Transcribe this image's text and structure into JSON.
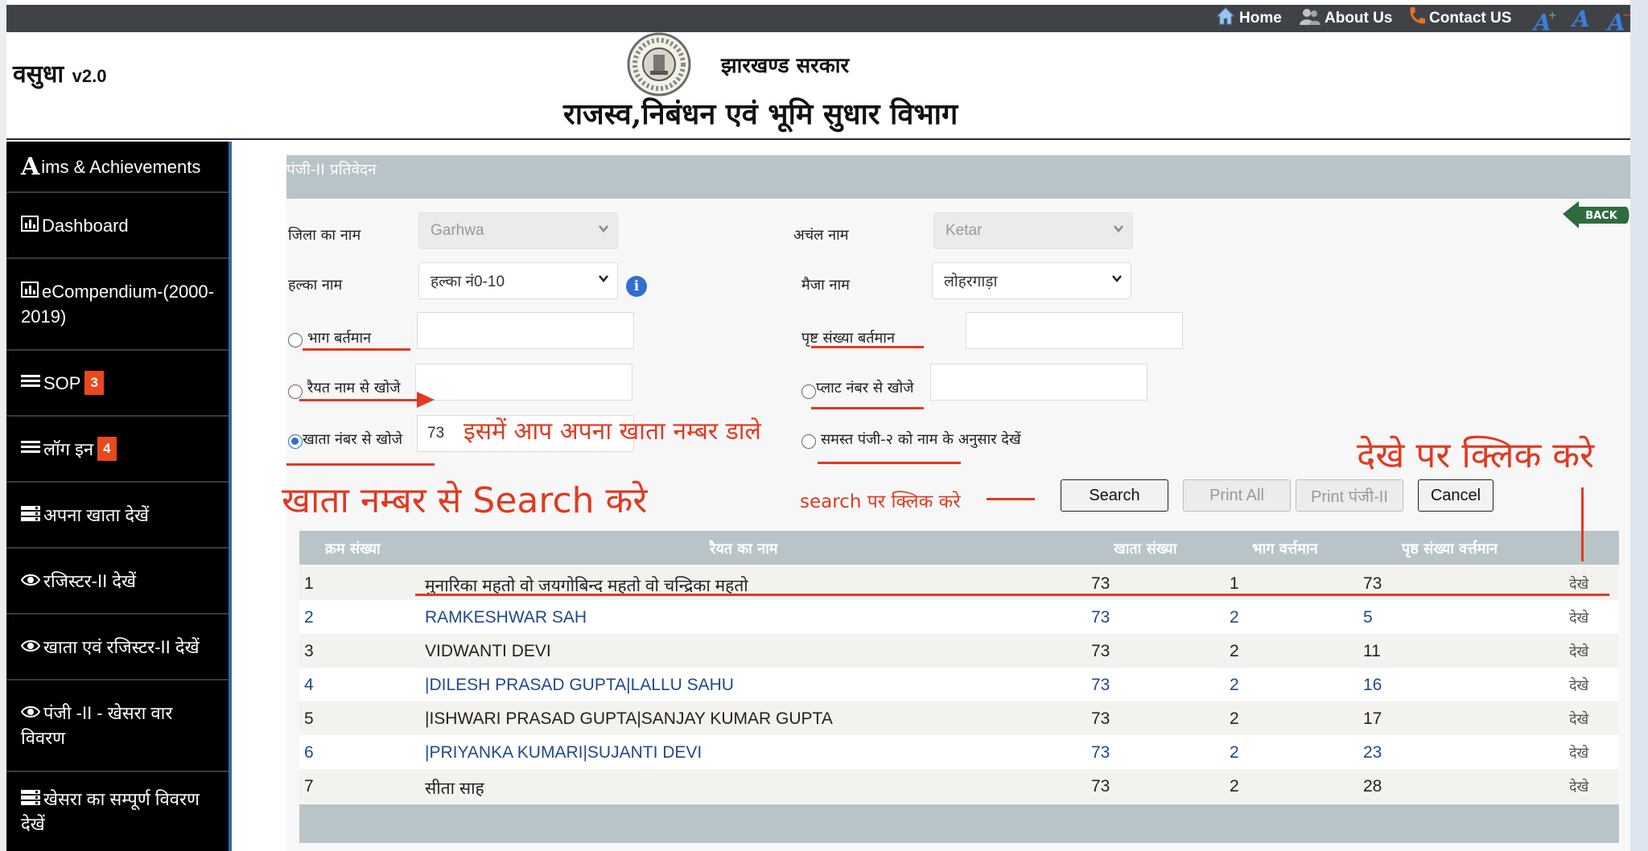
{
  "topbar": {
    "home": "Home",
    "about": "About Us",
    "contact": "Contact US",
    "font_increase": "A",
    "font_reset": "A",
    "font_decrease": "A",
    "font_increase_sign": "+",
    "font_decrease_sign": "−"
  },
  "header": {
    "brand": "वसुधा",
    "version": "v2.0",
    "gov_name": "झारखण्ड सरकार",
    "dept_name": "राजस्व,निबंधन एवं भूमि सुधार  विभाग"
  },
  "sidebar": {
    "items": [
      {
        "icon": "A",
        "label": "ims & Achievements"
      },
      {
        "icon": "bar-chart-icon",
        "label": "Dashboard"
      },
      {
        "icon": "bar-chart-icon",
        "label": "eCompendium-(2000-2019)"
      },
      {
        "icon": "list-icon",
        "label": "SOP",
        "badge": "3"
      },
      {
        "icon": "list-icon",
        "label": "लॉग इन",
        "badge": "4"
      },
      {
        "icon": "server-icon",
        "label": "अपना खाता देखें"
      },
      {
        "icon": "eye-icon",
        "label": "रजिस्टर-II देखें"
      },
      {
        "icon": "eye-icon",
        "label": "खाता एवं रजिस्टर-II देखें"
      },
      {
        "icon": "eye-icon",
        "label": "पंजी -II - खेसरा वार विवरण"
      },
      {
        "icon": "server-icon",
        "label": "खेसरा का सम्पूर्ण विवरण देखें"
      }
    ]
  },
  "panel": {
    "title": "पंजी-II प्रतिवेदन",
    "back_label": "BACK"
  },
  "form": {
    "district_label": "जिला का नाम",
    "district_value": "Garhwa",
    "circle_label": "अचंल नाम",
    "circle_value": "Ketar",
    "halka_label": "हल्का नाम",
    "halka_value": "हल्का नं0-10",
    "mauza_label": "मैजा नाम",
    "mauza_value": "लोहरगाड़ा",
    "bhag_label": "भाग बर्तमान",
    "page_label": "पृष्ट संख्या बर्तमान",
    "raiyat_label": "रैयत नाम से खोजे",
    "plot_label": "प्लाट नंबर से खोजे",
    "khata_label": "खाता नंबर से खोजे",
    "khata_value": "73",
    "all_label": "समस्त पंजी-२ को नाम के अनुसार देखें"
  },
  "buttons": {
    "search": "Search",
    "print_all": "Print All",
    "print_panji": "Print पंजी-II",
    "cancel": "Cancel"
  },
  "annotations": {
    "enter_khata": "इसमें आप अपना खाता नम्बर डाले",
    "search_by_khata": "खाता नम्बर से Search  करे",
    "click_search": "search  पर क्लिक करे",
    "click_view": "देखे पर क्लिक करे"
  },
  "table": {
    "headers": [
      "क्रम संख्या",
      "रैयत का नाम",
      "खाता संख्या",
      "भाग वर्त्तमान",
      "पृष्ठ संख्या वर्त्तमान"
    ],
    "view_label": "देखे",
    "rows": [
      {
        "sn": "1",
        "name": "मुनारिका महतो वो जयगोबिन्द महतो वो चन्द्रिका महतो",
        "khata": "73",
        "bhag": "1",
        "page": "73"
      },
      {
        "sn": "2",
        "name": "RAMKESHWAR SAH",
        "khata": "73",
        "bhag": "2",
        "page": "5"
      },
      {
        "sn": "3",
        "name": "VIDWANTI DEVI",
        "khata": "73",
        "bhag": "2",
        "page": "11"
      },
      {
        "sn": "4",
        "name": "|DILESH PRASAD GUPTA|LALLU SAHU",
        "khata": "73",
        "bhag": "2",
        "page": "16"
      },
      {
        "sn": "5",
        "name": "|ISHWARI PRASAD GUPTA|SANJAY KUMAR GUPTA",
        "khata": "73",
        "bhag": "2",
        "page": "17"
      },
      {
        "sn": "6",
        "name": "|PRIYANKA KUMARI|SUJANTI DEVI",
        "khata": "73",
        "bhag": "2",
        "page": "23"
      },
      {
        "sn": "7",
        "name": "सीता साह",
        "khata": "73",
        "bhag": "2",
        "page": "28"
      }
    ]
  },
  "colors": {
    "annotation": "#e03a22",
    "topbar": "#3f4347",
    "sidebar": "#000000",
    "table_header": "#b9c4c9",
    "badge": "#e8491d"
  }
}
